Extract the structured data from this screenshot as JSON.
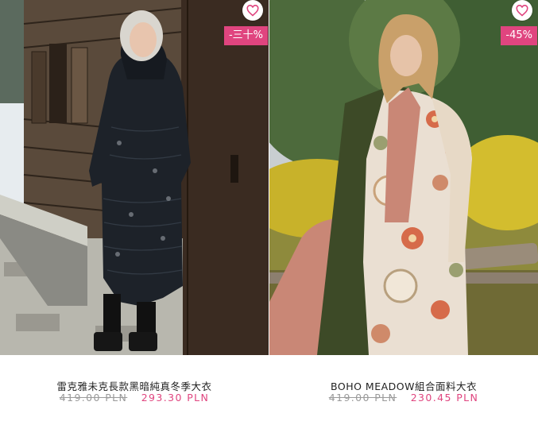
{
  "products": [
    {
      "name": "雷克雅未克長款黑暗純真冬季大衣",
      "old_price": "419.00 PLN",
      "new_price": "293.30 PLN",
      "discount": "-三十%",
      "wishlist_icon": "heart-outline-icon",
      "image": "woman-in-dark-floral-puffer-coat-by-wooden-cabin"
    },
    {
      "name": "BOHO MEADOW組合面料大衣",
      "old_price": "419.00 PLN",
      "new_price": "230.45 PLN",
      "discount": "-45%",
      "wishlist_icon": "heart-outline-icon",
      "image": "woman-in-floral-patchwork-coat-in-meadow"
    }
  ],
  "colors": {
    "accent": "#e0457f",
    "old_price": "#9a9a9a"
  }
}
